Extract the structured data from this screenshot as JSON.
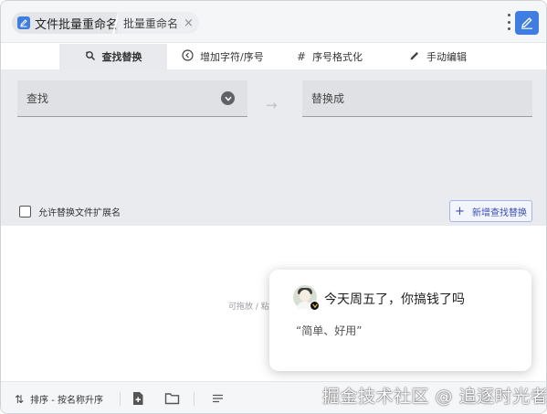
{
  "titlebar": {
    "app_title": "文件批量重命名",
    "tab_label": "批量重命名",
    "close_glyph": "×"
  },
  "tabs": [
    {
      "label": "查找替换",
      "icon": "search-replace-icon",
      "glyph": "⟲"
    },
    {
      "label": "增加字符/序号",
      "icon": "add-circle-icon",
      "glyph": "⊕"
    },
    {
      "label": "序号格式化",
      "icon": "hash-icon",
      "glyph": "#"
    },
    {
      "label": "手动编辑",
      "icon": "pencil-icon",
      "glyph": "✎"
    }
  ],
  "find_replace": {
    "find_placeholder": "查找",
    "replace_placeholder": "替换成",
    "arrow_glyph": "→",
    "allow_extension_label": "允许替换文件扩展名",
    "add_rule_label": "新增查找替换",
    "add_glyph": "+"
  },
  "drop_area": {
    "hint": "可拖放 / 粘贴"
  },
  "popup": {
    "title": "今天周五了，你搞钱了吗",
    "quote": "“简单、好用”"
  },
  "bottombar": {
    "sort_label": "排序 - 按名称升序",
    "sort_glyph": "⇅"
  },
  "watermark": "掘金技术社区 @ 追逐时光者",
  "colors": {
    "accent": "#3f7de0",
    "panel_bg": "#eaebef",
    "add_button_text": "#3a4fb8"
  }
}
